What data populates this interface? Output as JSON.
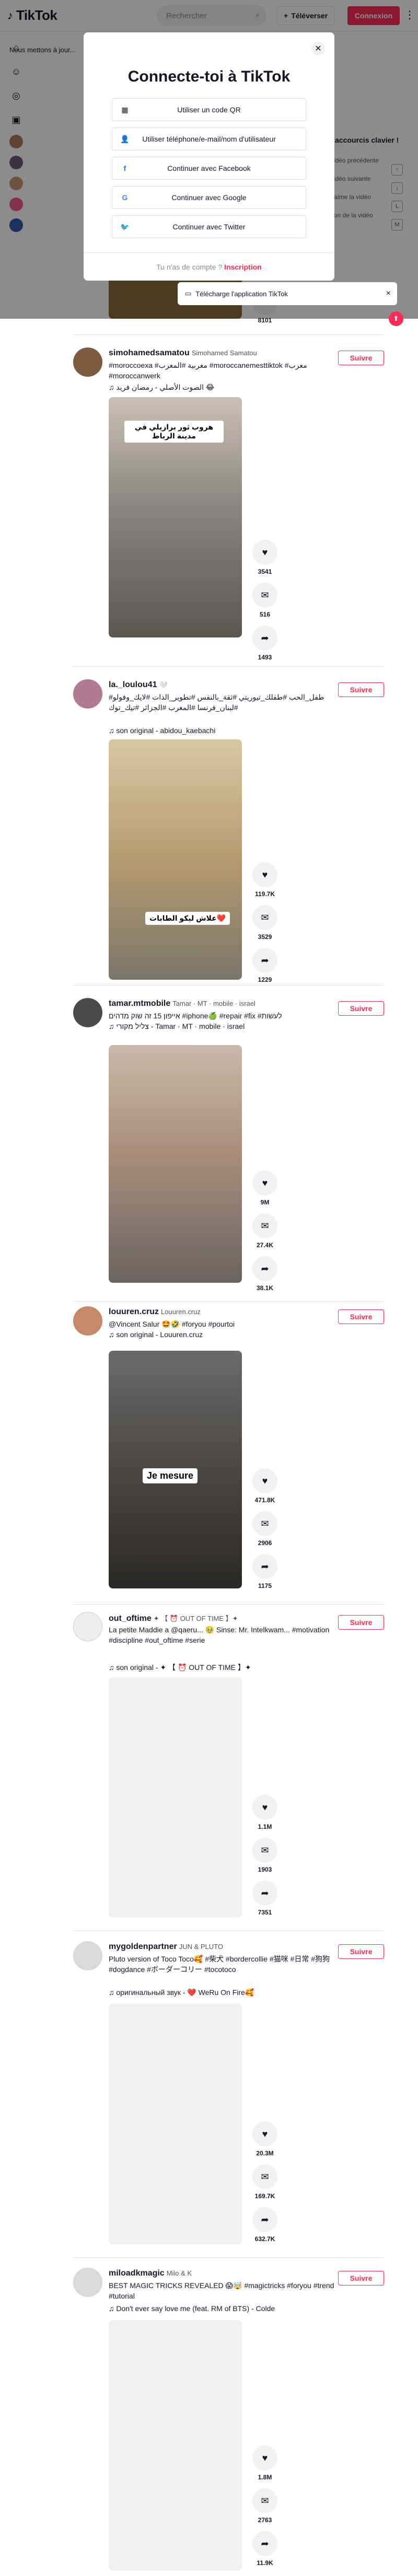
{
  "header": {
    "logo_text": "TikTok",
    "search_placeholder": "Rechercher",
    "upload_label": "Téléverser",
    "login_label": "Connexion"
  },
  "sidebar": {
    "notice_text": "Nous mettons à jour..."
  },
  "modal": {
    "title": "Connecte-toi à TikTok",
    "options": [
      {
        "icon": "qr-code-icon",
        "label": "Utiliser un code QR"
      },
      {
        "icon": "person-icon",
        "label": "Utiliser téléphone/e-mail/nom d'utilisateur"
      },
      {
        "icon": "facebook-icon",
        "label": "Continuer avec Facebook"
      },
      {
        "icon": "google-icon",
        "label": "Continuer avec Google"
      },
      {
        "icon": "twitter-icon",
        "label": "Continuer avec Twitter"
      }
    ],
    "footer_text": "Tu n'as de compte ?",
    "footer_link": "Inscription"
  },
  "keyboard_panel": {
    "title": "Raccourcis clavier !",
    "rows": [
      {
        "label": "Vidéo précédente",
        "key": "↑"
      },
      {
        "label": "Vidéo suivante",
        "key": "↓"
      },
      {
        "label": "J'aime la vidéo",
        "key": "L"
      },
      {
        "label": "Son de la vidéo",
        "key": "M"
      }
    ]
  },
  "desktop_banner": {
    "label": "Télécharge l'application TikTok"
  },
  "peek_count": "8101",
  "posts": [
    {
      "username": "simohamedsamatou",
      "nickname": "Simohamed Samatou",
      "caption": "#moroccoexa #مغربية #المغرب #moroccanemesttiktok #مغرب #moroccanwerk",
      "music": "♫ الصوت الأصلي - رمضان فريد 😂",
      "video_caption": "هروب ثور برازيلي في مدينة الرباط",
      "likes": "3541",
      "comments": "516",
      "shares": "1493"
    },
    {
      "username": "la._loulou41",
      "nickname": "🤍",
      "caption": "#طفل_الحب #طفلك_تيوريتي #ثقة_بالنفس #تطوير_الذات #لايك_وفولو #لبنان_فرنسا #المغرب #الجزائر #تيك_توك",
      "music": "♫ son original - abidou_kaebachi",
      "video_caption": "علاش ليكو الطابات❤️",
      "likes": "119.7K",
      "comments": "3529",
      "shares": "1229"
    },
    {
      "username": "tamar.mtmobile",
      "nickname": "Tamar · MT · mobile · israel",
      "caption": "אייפון 15 זה שוק מדהים #iphone🍏 #repair #fix #לעשות",
      "music": "♫ צליל מקורי - Tamar · MT · mobile · israel",
      "video_caption": "",
      "likes": "9M",
      "comments": "27.4K",
      "shares": "38.1K"
    },
    {
      "username": "louuren.cruz",
      "nickname": "Louuren.cruz",
      "caption": "@Vincent Salur 🤩🤣 #foryou #pourtoi",
      "music": "♫ son original - Louuren.cruz",
      "video_caption": "Je mesure",
      "likes": "471.8K",
      "comments": "2906",
      "shares": "1175"
    },
    {
      "username": "out_oftime",
      "nickname": "✦ 【 ⏰ OUT OF TIME 】✦",
      "caption": "La petite Maddie a @qaeru... 🥹 Sinse: Mr. Intelkwam... #motivation #discipline #out_oftime #serie",
      "music": "♫ son original - ✦ 【 ⏰ OUT OF TIME 】✦",
      "video_caption": "",
      "likes": "1.1M",
      "comments": "1903",
      "shares": "7351"
    },
    {
      "username": "mygoldenpartner",
      "nickname": "JUN & PLUTO",
      "caption": "Pluto version of Toco Toco🥰 #柴犬 #bordercollie #猫咪 #日常 #狗狗 #dogdance #ボーダーコリー #tocotoco",
      "music": "♫ оригинальный звук - ❤️ WeRu On Fire🥰",
      "video_caption": "",
      "likes": "20.3M",
      "comments": "169.7K",
      "shares": "632.7K"
    },
    {
      "username": "miloadkmagic",
      "nickname": "Milo & K",
      "caption": "BEST MAGIC TRICKS REVEALED 😱🤯 #magictricks #foryou #trend #tutorial",
      "music": "♫ Don't ever say love me (feat. RM of BTS) - Colde",
      "video_caption": "",
      "likes": "1.8M",
      "comments": "2763",
      "shares": "11.9K"
    }
  ],
  "follow_label": "Suivre",
  "colors": {
    "brand": "#fe2c55",
    "text": "#161823",
    "muted": "#8a8b91"
  }
}
